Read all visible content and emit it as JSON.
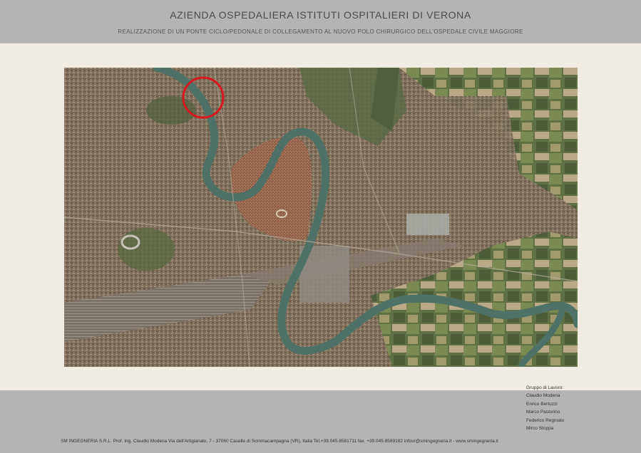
{
  "header": {
    "title": "AZIENDA OSPEDALIERA ISTITUTI OSPITALIERI DI VERONA",
    "subtitle": "REALIZZAZIONE DI UN PONTE CICLO/PEDONALE DI COLLEGAMENTO AL NUOVO POLO CHIRURGICO DELL’OSPEDALE CIVILE MAGGIORE"
  },
  "map": {
    "kind": "aerial satellite photo of Verona with the Adige river",
    "highlight_color": "#d8161e",
    "river_color": "#4e7268"
  },
  "team": {
    "heading": "Gruppo di Lavoro:",
    "members": [
      "Claudio Modena",
      "Enrico Bertuzzi",
      "Marco Pastorino",
      "Federico Reginato",
      "Mirco Stoppa"
    ]
  },
  "footer": {
    "contact": "SM INGEGNERIA S.R.L. Prof. Ing. Claudio  Modena Via dell'Artigianato, 7 - 37060 Caselle di Sommacampagna (VR), Italia  Tel.+39.045.8581711 fax. +39.045.8589182 infovr@smingegneria.it - www.smingegneria.it"
  }
}
